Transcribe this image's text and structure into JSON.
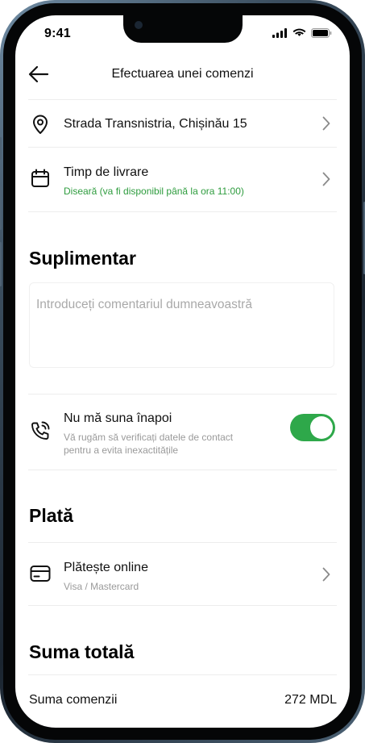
{
  "status_bar": {
    "time": "9:41"
  },
  "header": {
    "title": "Efectuarea unei comenzi",
    "back_icon": "arrow-left-icon"
  },
  "address": {
    "icon": "location-pin-icon",
    "label": "Strada Transnistria, Chișinău 15"
  },
  "delivery_time": {
    "icon": "calendar-icon",
    "label": "Timp de livrare",
    "value": "Diseară (va fi disponibil până la ora 11:00)",
    "value_color": "#2e9c3e"
  },
  "extra": {
    "title": "Suplimentar",
    "comment_placeholder": "Introduceți comentariul dumneavoastră"
  },
  "callback": {
    "icon": "phone-call-icon",
    "label": "Nu mă suna înapoi",
    "description_line1": "Vă rugăm să verificați datele de contact",
    "description_line2": "pentru a evita inexactitățile",
    "toggle_on": true,
    "toggle_color": "#2ea84a"
  },
  "payment": {
    "title": "Plată",
    "icon": "credit-card-icon",
    "label": "Plătește online",
    "sub": "Visa / Mastercard"
  },
  "total": {
    "title": "Suma totală",
    "order_label": "Suma comenzii",
    "order_value": "272 MDL"
  }
}
